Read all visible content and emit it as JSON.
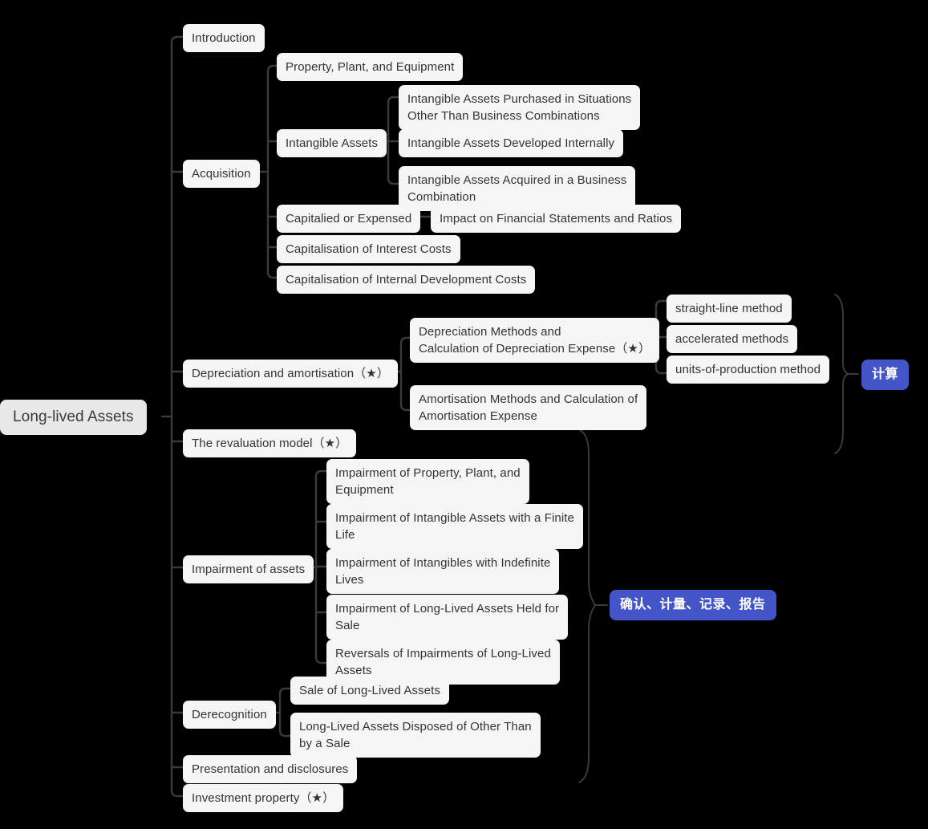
{
  "diagram": {
    "type": "mind-map",
    "title": "Long-lived Assets",
    "background_color": "#000000",
    "node_color": "#f5f5f5",
    "root_color": "#e8e8e8",
    "text_color": "#333333",
    "edge_color": "#3a3a3a",
    "badge_color": "#4355c7",
    "badge_text_color": "#ffffff"
  },
  "root": {
    "label": "Long-lived Assets"
  },
  "nodes": {
    "introduction": {
      "label": "Introduction"
    },
    "acquisition": {
      "label": "Acquisition"
    },
    "ppe": {
      "label": "Property, Plant, and Equipment"
    },
    "intangible_assets": {
      "label": "Intangible Assets"
    },
    "ia_purchased": {
      "label": "Intangible Assets Purchased in Situations\nOther Than Business Combinations"
    },
    "ia_developed": {
      "label": "Intangible Assets Developed Internally"
    },
    "ia_acquired": {
      "label": "Intangible Assets Acquired in a Business\nCombination"
    },
    "capitalied_or_expensed": {
      "label": "Capitalied or Expensed"
    },
    "impact_on_fs": {
      "label": "Impact on Financial Statements and Ratios"
    },
    "cap_interest": {
      "label": "Capitalisation of Interest Costs"
    },
    "cap_internal_dev": {
      "label": "Capitalisation of Internal Development Costs"
    },
    "depreciation_amortisation": {
      "label": "Depreciation and amortisation（★）"
    },
    "depr_methods": {
      "label": "Depreciation Methods and\nCalculation of Depreciation Expense（★）"
    },
    "straight_line": {
      "label": "straight-line method"
    },
    "accelerated": {
      "label": "accelerated methods"
    },
    "units_of_production": {
      "label": "units-of-production method"
    },
    "amort_methods": {
      "label": "Amortisation Methods and Calculation of\nAmortisation Expense"
    },
    "revaluation_model": {
      "label": "The revaluation model（★）"
    },
    "impairment_of_assets": {
      "label": "Impairment of assets"
    },
    "imp_ppe": {
      "label": "Impairment of Property, Plant, and\nEquipment"
    },
    "imp_finite": {
      "label": "Impairment of Intangible Assets with a Finite\nLife"
    },
    "imp_indefinite": {
      "label": "Impairment of Intangibles with Indefinite\nLives"
    },
    "imp_held_for_sale": {
      "label": "Impairment of Long-Lived Assets Held for\nSale"
    },
    "imp_reversals": {
      "label": "Reversals of Impairments of Long-Lived\nAssets"
    },
    "derecognition": {
      "label": "Derecognition"
    },
    "sale_of_lla": {
      "label": "Sale of Long-Lived Assets"
    },
    "disposed_other": {
      "label": "Long-Lived Assets Disposed of Other Than\nby a Sale"
    },
    "presentation_disclosures": {
      "label": "Presentation and disclosures"
    },
    "investment_property": {
      "label": "Investment property（★）"
    }
  },
  "badges": {
    "jisuan": {
      "label": "计算"
    },
    "querenjiliang": {
      "label": "确认、计量、记录、报告"
    }
  }
}
